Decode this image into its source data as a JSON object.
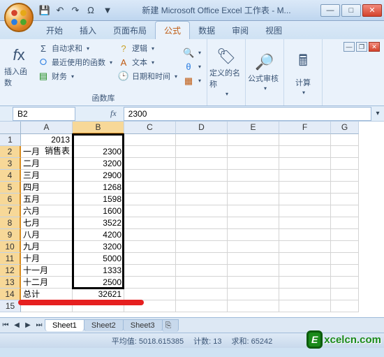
{
  "window": {
    "title": "新建 Microsoft Office Excel 工作表 - M..."
  },
  "tabs": [
    "开始",
    "插入",
    "页面布局",
    "公式",
    "数据",
    "审阅",
    "视图"
  ],
  "active_tab": "公式",
  "ribbon": {
    "insert_fn": "插入函数",
    "autosum": "自动求和",
    "recent": "最近使用的函数",
    "financial": "财务",
    "logical": "逻辑",
    "text": "文本",
    "datetime": "日期和时间",
    "lib_label": "函数库",
    "names": "定义的名称",
    "audit": "公式审核",
    "calc": "计算"
  },
  "namebox": "B2",
  "formula": "2300",
  "columns": [
    "A",
    "B",
    "C",
    "D",
    "E",
    "F",
    "G"
  ],
  "title_cell": "2013销售表",
  "chart_data": {
    "type": "table",
    "title": "2013销售表",
    "categories": [
      "一月",
      "二月",
      "三月",
      "四月",
      "五月",
      "六月",
      "七月",
      "八月",
      "九月",
      "十月",
      "十一月",
      "十二月"
    ],
    "values": [
      2300,
      3200,
      2900,
      1268,
      1598,
      1600,
      3522,
      4200,
      3200,
      5000,
      1333,
      2500
    ],
    "total_label": "总计",
    "total_value": 32621
  },
  "sheets": [
    "Sheet1",
    "Sheet2",
    "Sheet3"
  ],
  "status": {
    "avg_label": "平均值:",
    "avg": "5018.615385",
    "count_label": "计数:",
    "count": "13",
    "sum_label": "求和:",
    "sum": "65242"
  },
  "watermark": {
    "badge": "E",
    "text": "xcelcn.com"
  }
}
